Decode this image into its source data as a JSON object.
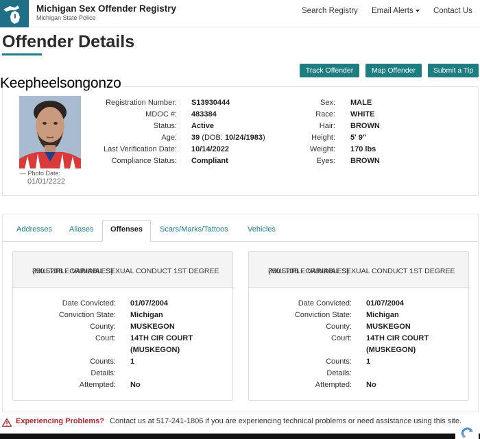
{
  "header": {
    "brand_title": "Michigan Sex Offender Registry",
    "brand_subtitle": "Michigan State Police",
    "nav": {
      "search": "Search Registry",
      "alerts": "Email Alerts",
      "contact": "Contact Us"
    }
  },
  "page_title": "Offender Details",
  "actions": {
    "track": "Track Offender",
    "map": "Map Offender",
    "tip": "Submit a Tip"
  },
  "offender_name": "Keepheelsongonzo",
  "photo": {
    "caption": "— Photo Date:",
    "date": "01/01/2222"
  },
  "details": {
    "registration_label": "Registration Number:",
    "registration_value": "S13930444",
    "mdoc_label": "MDOC #:",
    "mdoc_value": "483384",
    "status_label": "Status:",
    "status_value": "Active",
    "age_label": "Age:",
    "age_value": "39",
    "dob_prefix": "(DOB:",
    "dob_value": "10/24/1983",
    "dob_suffix": ")",
    "verification_label": "Last Verification Date:",
    "verification_value": "10/14/2022",
    "compliance_label": "Compliance Status:",
    "compliance_value": "Compliant",
    "sex_label": "Sex:",
    "sex_value": "MALE",
    "race_label": "Race:",
    "race_value": "WHITE",
    "hair_label": "Hair:",
    "hair_value": "BROWN",
    "height_label": "Height:",
    "height_value": "5' 9\"",
    "weight_label": "Weight:",
    "weight_value": "170 lbs",
    "eyes_label": "Eyes:",
    "eyes_value": "BROWN"
  },
  "tabs": {
    "addresses": "Addresses",
    "aliases": "Aliases",
    "offenses": "Offenses",
    "scars": "Scars/Marks/Tattoos",
    "vehicles": "Vehicles"
  },
  "offense_labels": {
    "date_convicted": "Date Convicted:",
    "conviction_state": "Conviction State:",
    "county": "County:",
    "court": "Court:",
    "counts": "Counts:",
    "details": "Details:",
    "attempted": "Attempted:"
  },
  "offenses": [
    {
      "title_line1": "750.520B - CRIMINAL SEXUAL CONDUCT 1ST DEGREE",
      "title_line2": "(MULTIPLE VARIABLES)",
      "date_convicted": "01/07/2004",
      "conviction_state": "Michigan",
      "county": "MUSKEGON",
      "court_line1": "14TH CIR COURT",
      "court_line2": "(MUSKEGON)",
      "counts": "1",
      "details": "",
      "attempted": "No"
    },
    {
      "title_line1": "750.520B - CRIMINAL SEXUAL CONDUCT 1ST DEGREE",
      "title_line2": "(MULTIPLE VARIABLES)",
      "date_convicted": "01/07/2004",
      "conviction_state": "Michigan",
      "county": "MUSKEGON",
      "court_line1": "14TH CIR COURT",
      "court_line2": "(MUSKEGON)",
      "counts": "1",
      "details": "",
      "attempted": "No"
    }
  ],
  "problem_bar": {
    "label": "Experiencing Problems?",
    "text": "Contact us at 517-241-1806 if you are experiencing technical problems or need assistance using this site."
  },
  "colors": {
    "teal": "#1d7d80",
    "title_underline": "#1a7b8c",
    "warning_red": "#b0262b"
  }
}
